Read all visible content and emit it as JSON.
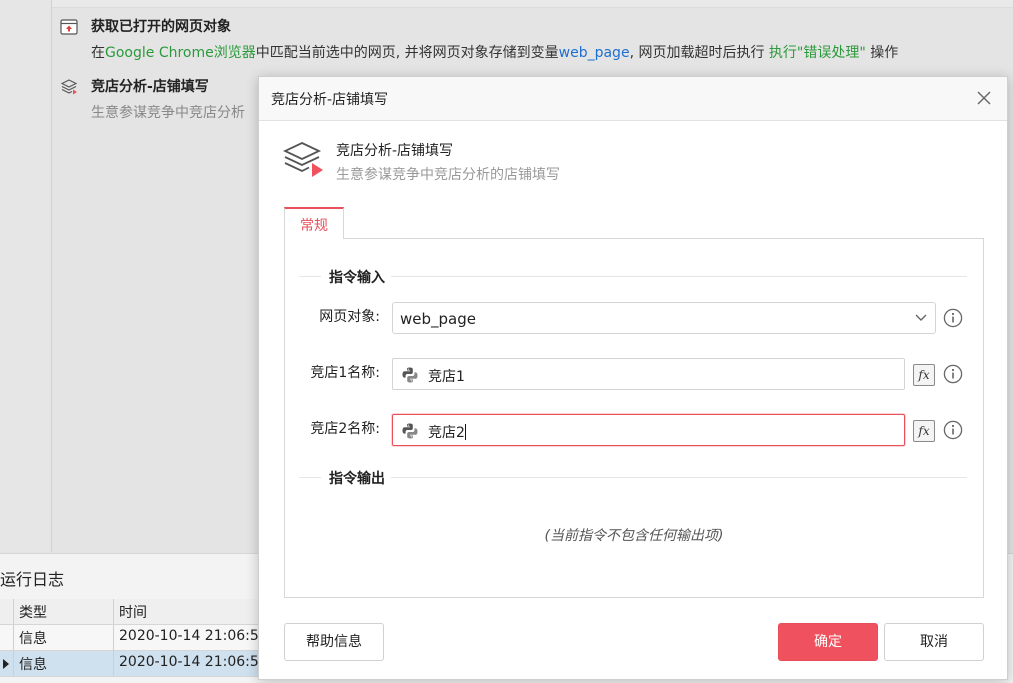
{
  "background": {
    "steps": [
      {
        "title": "获取已打开的网页对象",
        "desc_parts": [
          "在",
          "Google Chrome浏览器",
          "中匹配当前选中的网页, 并将网页对象存储到变量",
          "web_page",
          ", 网页加载超时后执行 ",
          "执行\"错误处理\"",
          " 操作"
        ]
      },
      {
        "title": "竞店分析-店铺填写",
        "desc": "生意参谋竞争中竞店分析"
      }
    ],
    "log": {
      "title": "运行日志",
      "headers": [
        "类型",
        "时间"
      ],
      "rows": [
        {
          "type": "信息",
          "time": "2020-10-14 21:06:5"
        },
        {
          "type": "信息",
          "time": "2020-10-14 21:06:5"
        }
      ]
    }
  },
  "dialog": {
    "title": "竞店分析-店铺填写",
    "command_name": "竞店分析-店铺填写",
    "command_desc": "生意参谋竞争中竞店分析的店铺填写",
    "tab": "常规",
    "input_section": "指令输入",
    "output_section": "指令输出",
    "fields": {
      "web_page": {
        "label": "网页对象:",
        "value": "web_page"
      },
      "shop1": {
        "label": "竞店1名称:",
        "value": "竞店1"
      },
      "shop2": {
        "label": "竞店2名称:",
        "value": "竞店2"
      }
    },
    "fx_label": "fx",
    "no_output_text": "(当前指令不包含任何输出项)",
    "buttons": {
      "help": "帮助信息",
      "ok": "确定",
      "cancel": "取消"
    }
  },
  "colors": {
    "accent": "#ef525e",
    "link_green": "#2a9a3a",
    "link_blue": "#1d6fd0"
  }
}
